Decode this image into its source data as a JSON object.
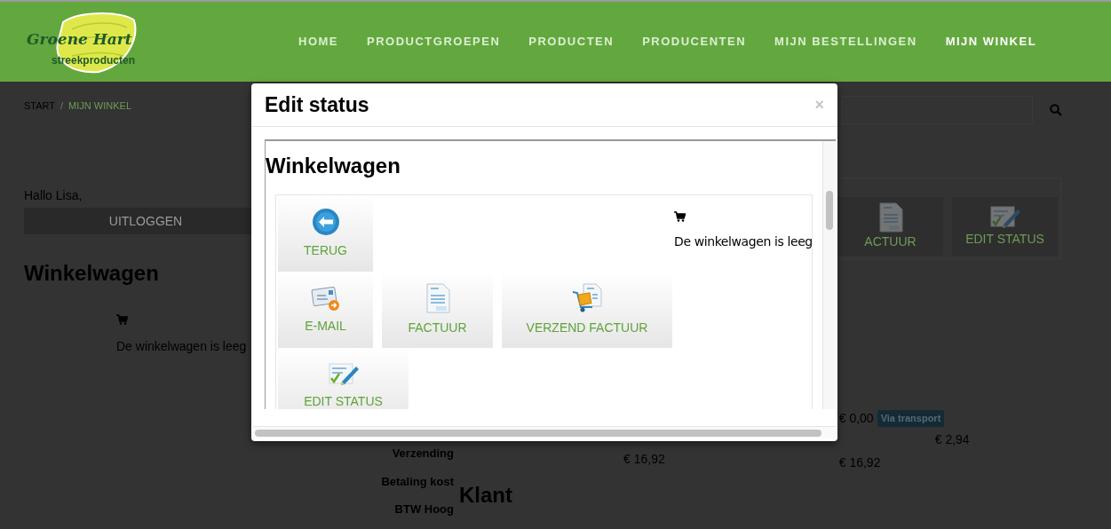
{
  "header": {
    "logo": {
      "script": "Groene Hart",
      "tagline": "streekproducten"
    },
    "nav": [
      {
        "label": "HOME",
        "selected": false
      },
      {
        "label": "PRODUCTGROEPEN",
        "selected": false
      },
      {
        "label": "PRODUCTEN",
        "selected": false
      },
      {
        "label": "PRODUCENTEN",
        "selected": false
      },
      {
        "label": "MIJN BESTELLINGEN",
        "selected": false
      },
      {
        "label": "MIJN WINKEL",
        "selected": true
      }
    ]
  },
  "page": {
    "breadcrumb": [
      "START",
      "MIJN WINKEL"
    ],
    "breadcrumb_separator": "/",
    "greeting": "Hallo Lisa,",
    "logout": "UITLOGGEN",
    "heading": "Winkelwagen",
    "cart_message": "De winkelwagen is leeg",
    "side_actions": [
      {
        "kind": "invoice",
        "label": "ACTUUR"
      },
      {
        "kind": "edit",
        "label": "EDIT STATUS"
      }
    ],
    "totals": {
      "labels": [
        "Verzending",
        "Betaling kost",
        "BTW Hoog"
      ],
      "klant": "Klant",
      "shipping_amount": "€ 0,00",
      "shipping_badge": "Via transport",
      "payment_amount": "€ 2,94",
      "total_left": "€ 16,92",
      "total_right": "€ 16,92"
    }
  },
  "modal": {
    "title": "Edit status",
    "close": "×",
    "heading": "Winkelwagen",
    "cart_message": "De winkelwagen is leeg",
    "actions": [
      [
        {
          "kind": "back",
          "label": "TERUG"
        }
      ],
      [
        {
          "kind": "email",
          "label": "E-MAIL"
        },
        {
          "kind": "invoice",
          "label": "FACTUUR"
        },
        {
          "kind": "send",
          "label": "VERZEND FACTUUR"
        }
      ],
      [
        {
          "kind": "edit",
          "label": "EDIT STATUS"
        }
      ]
    ]
  }
}
